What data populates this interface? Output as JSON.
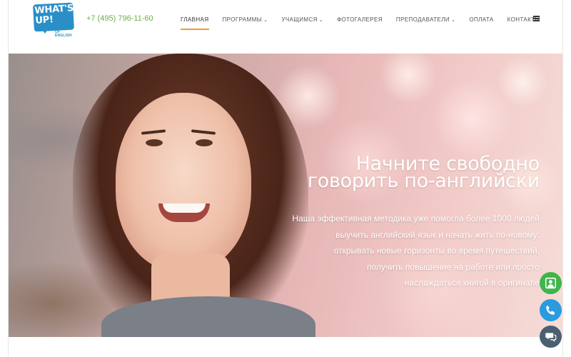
{
  "header": {
    "logo": {
      "line1": "WHAT'S",
      "line2": "UP!",
      "subtitle": "SCHOOL OF ENGLISH"
    },
    "phone": "+7 (495) 796-11-60",
    "nav": {
      "items": [
        {
          "label": "ГЛАВНАЯ",
          "dropdown": false,
          "active": true
        },
        {
          "label": "ПРОГРАММЫ",
          "dropdown": true,
          "active": false
        },
        {
          "label": "УЧАЩИМСЯ",
          "dropdown": true,
          "active": false
        },
        {
          "label": "ФОТОГАЛЕРЕЯ",
          "dropdown": false,
          "active": false
        },
        {
          "label": "ПРЕПОДАВАТЕЛИ",
          "dropdown": true,
          "active": false
        },
        {
          "label": "ОПЛАТА",
          "dropdown": false,
          "active": false
        },
        {
          "label": "КОНТАКТЫ",
          "dropdown": false,
          "active": false
        }
      ],
      "caret": "⌄",
      "menu_icon": "hamburger-menu-icon"
    }
  },
  "hero": {
    "headline": [
      "Начните свободно",
      "говорить по-английски"
    ],
    "description": [
      "Наша эффективная методика уже помогла более 1000 людей",
      "выучить английский язык и начать жить по-новому:",
      "открывать новые горизонты во время путешествий,",
      "получить повышение на работе или просто",
      "наслаждаться книгой в оригинале"
    ]
  },
  "floating_buttons": [
    {
      "icon": "callback-icon",
      "color": "#3fb54a"
    },
    {
      "icon": "phone-icon",
      "color": "#2b9be0"
    },
    {
      "icon": "chat-icon",
      "color": "#4a6072"
    }
  ],
  "colors": {
    "accent": "#f29a2e",
    "phone_text": "#6ab04c",
    "brand_blue": "#2a8fc7"
  }
}
